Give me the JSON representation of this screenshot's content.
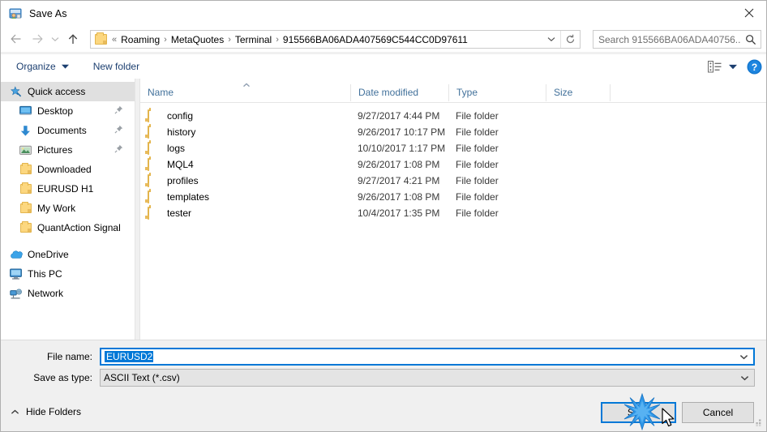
{
  "window": {
    "title": "Save As",
    "icon": "save-as-icon",
    "close_label": "✕"
  },
  "nav": {
    "back_icon": "arrow-left-icon",
    "forward_icon": "arrow-right-icon",
    "recent_icon": "chevron-down-icon",
    "up_icon": "arrow-up-icon"
  },
  "address": {
    "folder_icon": "folder-icon",
    "prefix": "«",
    "crumbs": [
      "Roaming",
      "MetaQuotes",
      "Terminal",
      "915566BA06ADA407569C544CC0D97611"
    ],
    "separator": "›",
    "dropdown_icon": "chevron-down-icon",
    "refresh_icon": "refresh-icon"
  },
  "search": {
    "text": "Search 915566BA06ADA40756...",
    "placeholder": "Search 915566BA06ADA40756...",
    "icon": "search-icon"
  },
  "toolbar": {
    "organize_label": "Organize",
    "organize_caret": "▼",
    "new_folder_label": "New folder",
    "view_icon": "list-view-icon",
    "view_caret": "▼",
    "help_icon": "help-icon",
    "help_glyph": "?"
  },
  "sidebar": {
    "groups": [
      {
        "header": {
          "label": "Quick access",
          "icon": "star-pin-icon",
          "selected": true
        },
        "items": [
          {
            "label": "Desktop",
            "icon": "desktop-icon",
            "pinned": true
          },
          {
            "label": "Documents",
            "icon": "documents-download-icon",
            "pinned": true
          },
          {
            "label": "Pictures",
            "icon": "pictures-icon",
            "pinned": true
          },
          {
            "label": "Downloaded",
            "icon": "folder-icon",
            "pinned": false
          },
          {
            "label": "EURUSD H1",
            "icon": "folder-icon",
            "pinned": false
          },
          {
            "label": "My Work",
            "icon": "folder-icon",
            "pinned": false
          },
          {
            "label": "QuantAction Signal",
            "icon": "folder-icon",
            "pinned": false
          }
        ]
      },
      {
        "header": {
          "label": "OneDrive",
          "icon": "onedrive-cloud-icon",
          "selected": false
        },
        "items": []
      },
      {
        "header": {
          "label": "This PC",
          "icon": "this-pc-icon",
          "selected": false
        },
        "items": []
      },
      {
        "header": {
          "label": "Network",
          "icon": "network-icon",
          "selected": false
        },
        "items": []
      }
    ]
  },
  "file_list": {
    "columns": [
      {
        "key": "name",
        "label": "Name"
      },
      {
        "key": "date",
        "label": "Date modified"
      },
      {
        "key": "type",
        "label": "Type"
      },
      {
        "key": "size",
        "label": "Size"
      }
    ],
    "sort_indicator": "▲",
    "rows": [
      {
        "name": "config",
        "date": "9/27/2017 4:44 PM",
        "type": "File folder",
        "size": "",
        "icon": "folder-icon"
      },
      {
        "name": "history",
        "date": "9/26/2017 10:17 PM",
        "type": "File folder",
        "size": "",
        "icon": "folder-icon"
      },
      {
        "name": "logs",
        "date": "10/10/2017 1:17 PM",
        "type": "File folder",
        "size": "",
        "icon": "folder-icon"
      },
      {
        "name": "MQL4",
        "date": "9/26/2017 1:08 PM",
        "type": "File folder",
        "size": "",
        "icon": "folder-icon"
      },
      {
        "name": "profiles",
        "date": "9/27/2017 4:21 PM",
        "type": "File folder",
        "size": "",
        "icon": "folder-icon"
      },
      {
        "name": "templates",
        "date": "9/26/2017 1:08 PM",
        "type": "File folder",
        "size": "",
        "icon": "folder-icon"
      },
      {
        "name": "tester",
        "date": "10/4/2017 1:35 PM",
        "type": "File folder",
        "size": "",
        "icon": "folder-icon"
      }
    ]
  },
  "form": {
    "file_name_label": "File name:",
    "file_name_value": "EURUSD2",
    "file_name_dropdown_icon": "chevron-down-icon",
    "save_as_type_label": "Save as type:",
    "save_as_type_value": "ASCII Text (*.csv)",
    "save_as_type_dropdown_icon": "chevron-down-icon"
  },
  "footer": {
    "hide_folders_label": "Hide Folders",
    "hide_folders_caret": "▲",
    "save_label": "Save",
    "cancel_label": "Cancel"
  },
  "colors": {
    "accent": "#0078d7",
    "column_header_text": "#42719b",
    "toolbar_text": "#1c3f70",
    "folder_fill": "#fcd77f",
    "selection": "#0078d7"
  }
}
